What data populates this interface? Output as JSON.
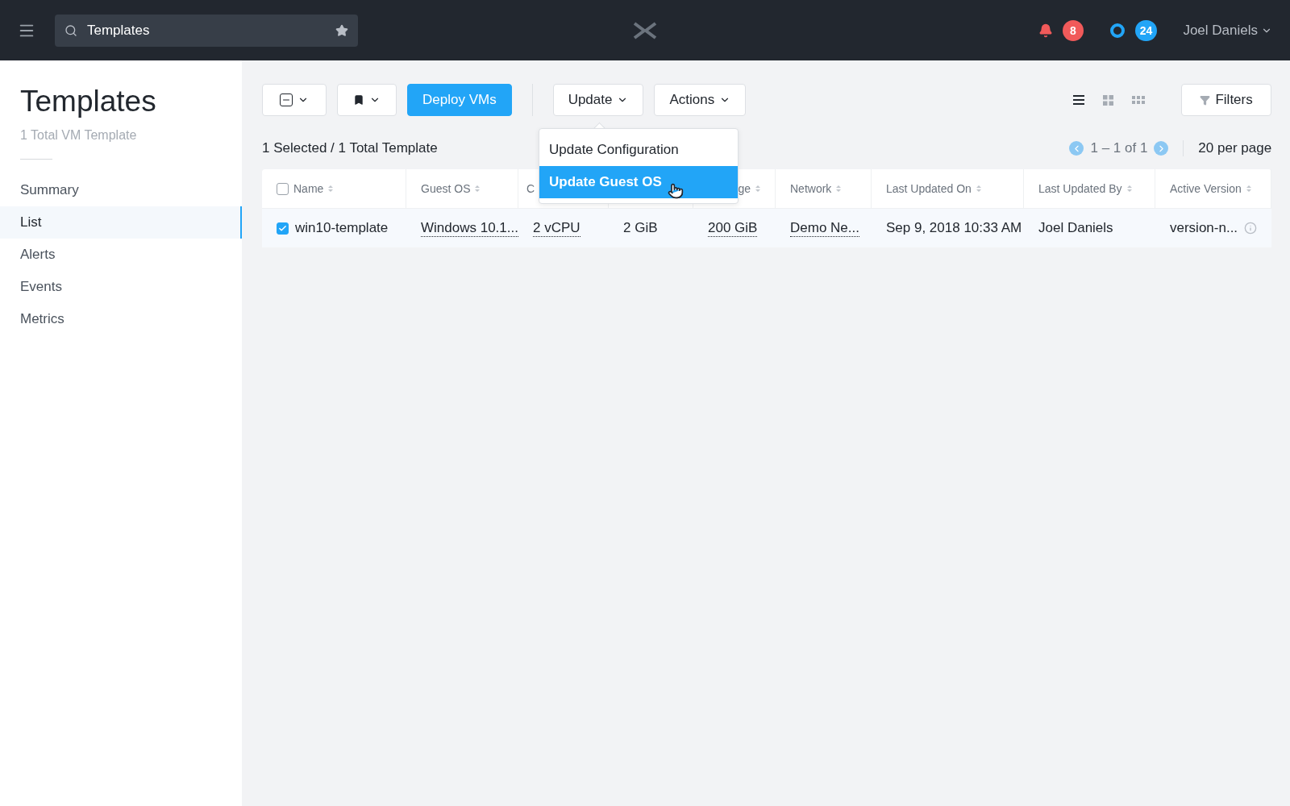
{
  "topbar": {
    "search": {
      "value": "Templates"
    },
    "alerts": {
      "count": "8"
    },
    "tasks": {
      "count": "24"
    },
    "user": "Joel Daniels"
  },
  "sidebar": {
    "title": "Templates",
    "subtitle": "1 Total VM Template",
    "items": [
      {
        "label": "Summary",
        "selected": false
      },
      {
        "label": "List",
        "selected": true
      },
      {
        "label": "Alerts",
        "selected": false
      },
      {
        "label": "Events",
        "selected": false
      },
      {
        "label": "Metrics",
        "selected": false
      }
    ]
  },
  "toolbar": {
    "deploy": "Deploy VMs",
    "update": "Update",
    "actions": "Actions",
    "filters": "Filters",
    "views": [
      {
        "kind": "list",
        "selected": true
      },
      {
        "kind": "grid",
        "selected": false
      },
      {
        "kind": "tiles",
        "selected": false
      }
    ]
  },
  "dropdown": {
    "items": [
      {
        "label": "Update Configuration",
        "selected": false
      },
      {
        "label": "Update Guest OS",
        "selected": true
      }
    ]
  },
  "summary": "1 Selected / 1 Total Template",
  "pagination": {
    "range": "1 – 1 of 1",
    "per_page": "20 per page"
  },
  "table": {
    "all_checked": false,
    "columns": [
      {
        "label": "Name"
      },
      {
        "label": "Guest OS"
      },
      {
        "label": "C"
      },
      {},
      {
        "label": "ge"
      },
      {
        "label": "Network"
      },
      {
        "label": "Last Updated On"
      },
      {
        "label": "Last Updated By"
      },
      {
        "label": "Active Version"
      }
    ],
    "rows": [
      {
        "checked": true,
        "cells": [
          {
            "text": "win10-template",
            "link": false
          },
          {
            "text": "Windows 10.1...",
            "link": true
          },
          {
            "text": "2 vCPU",
            "link": true
          },
          {
            "text": "2 GiB",
            "link": false
          },
          {
            "text": "200 GiB",
            "link": true
          },
          {
            "text": "Demo Ne...",
            "link": true
          },
          {
            "text": "Sep 9, 2018 10:33 AM",
            "link": false
          },
          {
            "text": "Joel Daniels",
            "link": false
          },
          {
            "text": "version-n...",
            "link": false,
            "info": true
          }
        ]
      }
    ]
  }
}
